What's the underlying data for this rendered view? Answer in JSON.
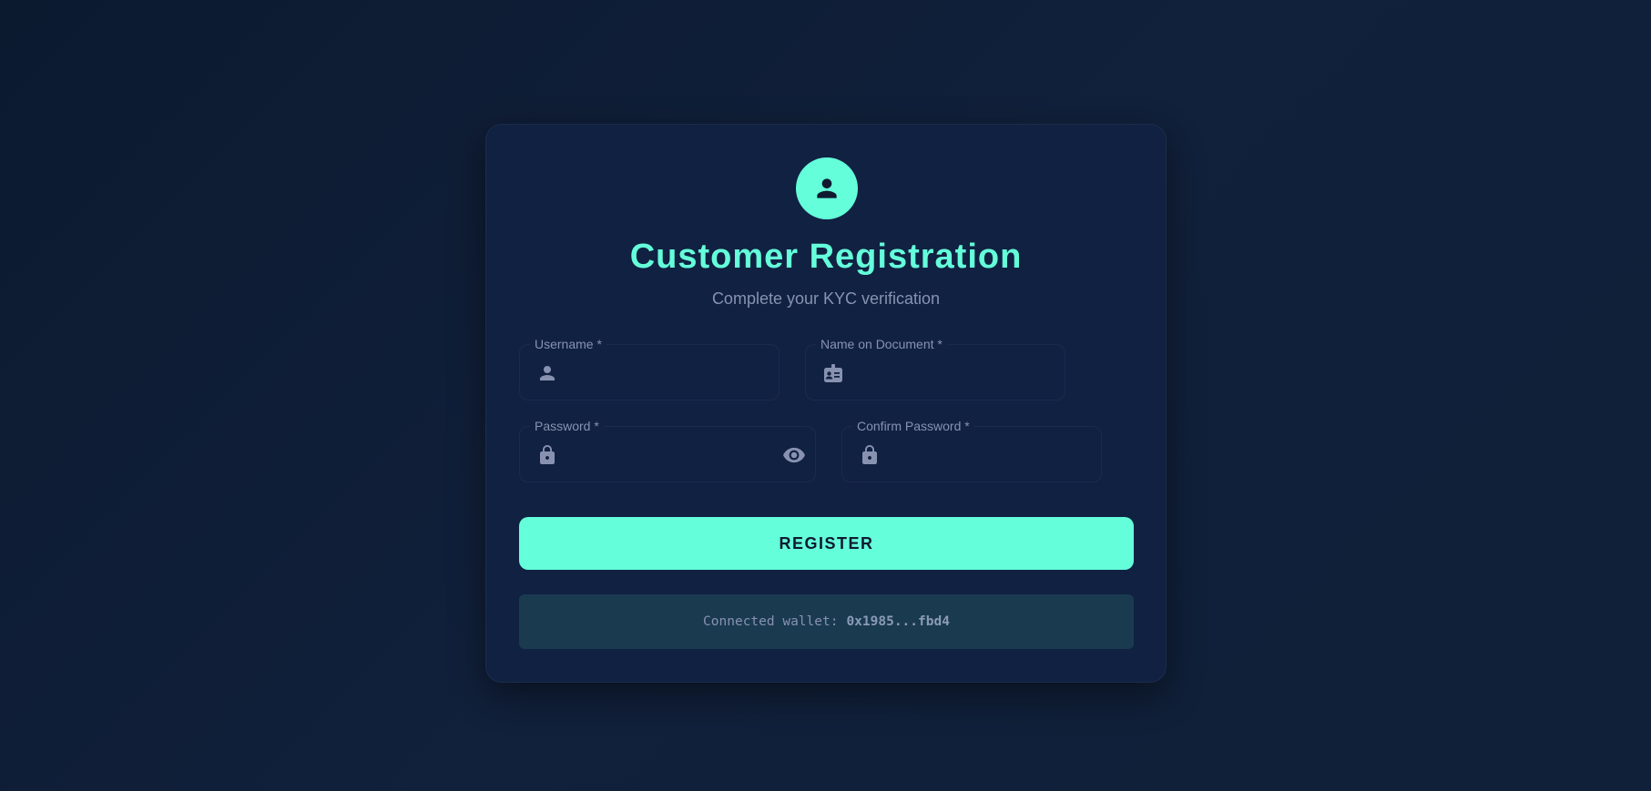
{
  "header": {
    "avatar_icon": "person-icon",
    "title": "Customer Registration",
    "subtitle": "Complete your KYC verification"
  },
  "form": {
    "username": {
      "label": "Username *",
      "value": "",
      "icon": "person-icon"
    },
    "name_on_document": {
      "label": "Name on Document *",
      "value": "",
      "icon": "id-card-icon"
    },
    "password": {
      "label": "Password *",
      "value": "",
      "icon": "lock-icon",
      "toggle_icon": "eye-icon"
    },
    "confirm_password": {
      "label": "Confirm Password *",
      "value": "",
      "icon": "lock-icon"
    },
    "submit_label": "REGISTER"
  },
  "wallet": {
    "prefix": "Connected wallet:",
    "address": "0x1985...fbd4"
  },
  "colors": {
    "accent": "#64ffda",
    "card_background": "#112142",
    "muted_text": "#8892b0",
    "wallet_background": "#1a3a50"
  }
}
